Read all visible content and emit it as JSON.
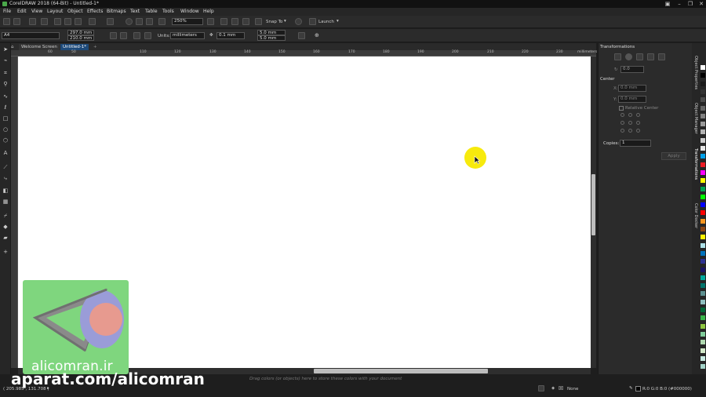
{
  "window": {
    "title": "CorelDRAW 2018 (64-Bit) - Untitled-1*"
  },
  "menu": [
    "File",
    "Edit",
    "View",
    "Layout",
    "Object",
    "Effects",
    "Bitmaps",
    "Text",
    "Table",
    "Tools",
    "Window",
    "Help"
  ],
  "toolbar": {
    "zoom_value": "250%",
    "snap_to_label": "Snap To",
    "launch_label": "Launch"
  },
  "property_bar": {
    "page_size": "A4",
    "width": "297.0 mm",
    "height": "210.0 mm",
    "units_label": "Units:",
    "units_value": "millimeters",
    "nudge": "0.1 mm",
    "dup_x": "5.0 mm",
    "dup_y": "5.0 mm"
  },
  "doc_tabs": {
    "welcome": "Welcome Screen",
    "untitled": "Untitled-1*"
  },
  "ruler": {
    "h_labels": [
      "60",
      "50",
      "110",
      "120",
      "130",
      "140",
      "150",
      "160",
      "170",
      "180",
      "190",
      "200",
      "210",
      "220",
      "230"
    ],
    "units": "millimeters"
  },
  "docker": {
    "title": "Transformations",
    "rotation_value": "0.0",
    "center_label": "Center",
    "x_label": "X:",
    "x_value": "0.0 mm",
    "y_label": "Y:",
    "y_value": "0.0 mm",
    "relative_center_label": "Relative Center",
    "copies_label": "Copies:",
    "copies_value": "1",
    "apply_label": "Apply"
  },
  "docker_tabs": [
    "Object Properties",
    "Object Manager",
    "Transformations",
    "Color Docker"
  ],
  "status": {
    "coordinates": "( 205.985 , 131.708 )",
    "hint": "Drag colors (or objects) here to store these colors with your document",
    "fill_label": "None",
    "outline_label": "R:0 G:0 B:0 (#000000)"
  },
  "palette_colors": [
    "#ffffff",
    "#000000",
    "#1a1a1a",
    "#333333",
    "#4d4d4d",
    "#666666",
    "#808080",
    "#999999",
    "#b3b3b3",
    "#cccccc",
    "#e6e6e6",
    "#00a0e9",
    "#ed1c24",
    "#ff00ff",
    "#ffff00",
    "#00a651",
    "#00ff00",
    "#0000ff",
    "#ff0000",
    "#f7941d",
    "#8b4513",
    "#fff200",
    "#aee1e8",
    "#0072bc",
    "#2e3192",
    "#1b1464",
    "#00a99d",
    "#00746b",
    "#5c8f8f",
    "#8fbfbf",
    "#006837",
    "#39b54a",
    "#8dc63f",
    "#7fcc9a",
    "#b0d9b0",
    "#d1e8c8",
    "#c7e9e0",
    "#a3d3c8"
  ],
  "watermark": {
    "site": "alicomran.ir",
    "channel": "aparat.com/alicomran"
  }
}
